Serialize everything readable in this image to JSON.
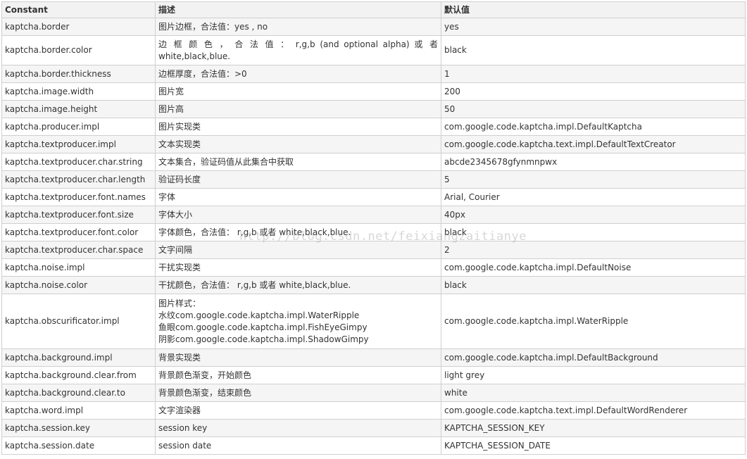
{
  "table": {
    "headers": [
      "Constant",
      "描述",
      "默认值"
    ],
    "rows": [
      {
        "constant": "kaptcha.border",
        "desc": "图片边框，合法值：yes , no",
        "default": "yes"
      },
      {
        "constant": "kaptcha.border.color",
        "desc_line1": "边 框 颜 色 ， 合 法 值 ： r,g,b (and optional alpha) 或 者",
        "desc_line2": "white,black,blue.",
        "default": "black"
      },
      {
        "constant": "kaptcha.border.thickness",
        "desc": "边框厚度，合法值：>0",
        "default": "1"
      },
      {
        "constant": "kaptcha.image.width",
        "desc": "图片宽",
        "default": "200"
      },
      {
        "constant": "kaptcha.image.height",
        "desc": "图片高",
        "default": "50"
      },
      {
        "constant": "kaptcha.producer.impl",
        "desc": "图片实现类",
        "default": "com.google.code.kaptcha.impl.DefaultKaptcha"
      },
      {
        "constant": "kaptcha.textproducer.impl",
        "desc": "文本实现类",
        "default": "com.google.code.kaptcha.text.impl.DefaultTextCreator"
      },
      {
        "constant": "kaptcha.textproducer.char.string",
        "desc": "文本集合，验证码值从此集合中获取",
        "default": "abcde2345678gfynmnpwx"
      },
      {
        "constant": "kaptcha.textproducer.char.length",
        "desc": "验证码长度",
        "default": "5"
      },
      {
        "constant": "kaptcha.textproducer.font.names",
        "desc": "字体",
        "default": "Arial, Courier"
      },
      {
        "constant": "kaptcha.textproducer.font.size",
        "desc": "字体大小",
        "default": "40px"
      },
      {
        "constant": "kaptcha.textproducer.font.color",
        "desc": "字体颜色，合法值： r,g,b 或者 white,black,blue.",
        "default": "black"
      },
      {
        "constant": "kaptcha.textproducer.char.space",
        "desc": "文字间隔",
        "default": "2"
      },
      {
        "constant": "kaptcha.noise.impl",
        "desc": "干扰实现类",
        "default": "com.google.code.kaptcha.impl.DefaultNoise"
      },
      {
        "constant": "kaptcha.noise.color",
        "desc": "干扰颜色，合法值： r,g,b 或者 white,black,blue.",
        "default": "black"
      },
      {
        "constant": "kaptcha.obscurificator.impl",
        "desc_lines": [
          "图片样式：",
          "水纹com.google.code.kaptcha.impl.WaterRipple",
          "鱼眼com.google.code.kaptcha.impl.FishEyeGimpy",
          "阴影com.google.code.kaptcha.impl.ShadowGimpy"
        ],
        "default": "com.google.code.kaptcha.impl.WaterRipple"
      },
      {
        "constant": "kaptcha.background.impl",
        "desc": "背景实现类",
        "default": "com.google.code.kaptcha.impl.DefaultBackground"
      },
      {
        "constant": "kaptcha.background.clear.from",
        "desc": "背景颜色渐变，开始颜色",
        "default": "light grey"
      },
      {
        "constant": "kaptcha.background.clear.to",
        "desc": "背景颜色渐变，结束颜色",
        "default": "white"
      },
      {
        "constant": "kaptcha.word.impl",
        "desc": "文字渲染器",
        "default": "com.google.code.kaptcha.text.impl.DefaultWordRenderer"
      },
      {
        "constant": "kaptcha.session.key",
        "desc": "session key",
        "default": "KAPTCHA_SESSION_KEY"
      },
      {
        "constant": "kaptcha.session.date",
        "desc": "session date",
        "default": "KAPTCHA_SESSION_DATE"
      }
    ]
  },
  "watermark": "http://blog.csdn.net/feixiangzaitianye",
  "colors": {
    "border": "#cfcfcf",
    "header_bg": "#f2f2f2",
    "row_alt_bg": "#f5f5f5",
    "text": "#333333"
  }
}
